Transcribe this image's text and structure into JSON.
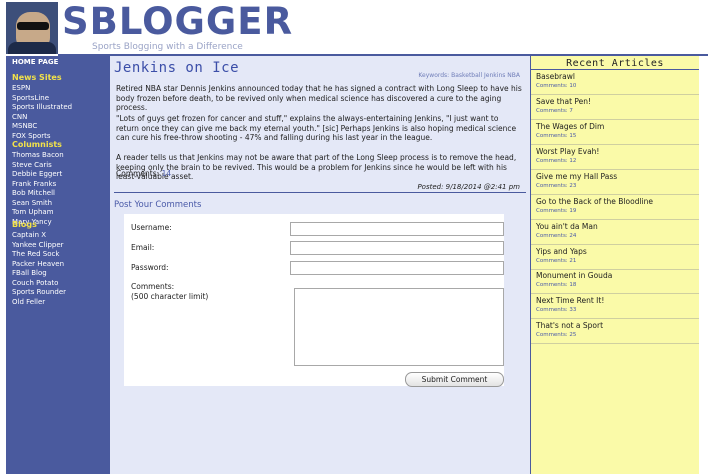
{
  "site": {
    "logo_text": "SBLOGGER",
    "tagline": "Sports Blogging with a Difference"
  },
  "sidebar": {
    "home": "HOME PAGE",
    "groups": [
      {
        "title": "News Sites",
        "items": [
          "ESPN",
          "SportsLine",
          "Sports Illustrated",
          "CNN",
          "MSNBC",
          "FOX Sports"
        ]
      },
      {
        "title": "Columnists",
        "items": [
          "Thomas Bacon",
          "Steve Caris",
          "Debbie Eggert",
          "Frank Franks",
          "Bob Mitchell",
          "Sean Smith",
          "Tom Upham",
          "Mary Yancy"
        ]
      },
      {
        "title": "Blogs",
        "items": [
          "Captain X",
          "Yankee Clipper",
          "The Red Sock",
          "Packer Heaven",
          "FBall Blog",
          "Couch Potato",
          "Sports Rounder",
          "Old Feller"
        ]
      }
    ]
  },
  "article": {
    "title": "Jenkins on Ice",
    "keywords": "Keywords: Basketball Jenkins NBA",
    "paragraphs": [
      "Retired NBA star Dennis Jenkins announced today that he has signed a contract with Long Sleep to have his body frozen before death, to be revived only when medical science has discovered a cure to the aging process.",
      "\"Lots of guys get frozen for cancer and stuff,\" explains the always-entertaining Jenkins, \"I just want to return once they can give me back my eternal youth.\" [sic] Perhaps Jenkins is also hoping medical science can cure his free-throw shooting - 47% and falling during his last year in the league.",
      "A reader tells us that Jenkins may not be aware that part of the Long Sleep process is to remove the head, keeping only the brain to be revived. This would be a problem for Jenkins since he would be left with his least-valuable asset."
    ],
    "comments_label": "Comments:",
    "comments_count": "14",
    "posted": "Posted: 9/18/2014 @2:41 pm"
  },
  "comment_form": {
    "title": "Post Your Comments",
    "username_label": "Username:",
    "email_label": "Email:",
    "password_label": "Password:",
    "comments_label": "Comments:",
    "comments_limit": "(500 character limit)",
    "submit_label": "Submit Comment"
  },
  "recent": {
    "title": "Recent Articles",
    "items": [
      {
        "title": "Basebrawl",
        "comments": "Comments: 10"
      },
      {
        "title": "Save that Pen!",
        "comments": "Comments: 7"
      },
      {
        "title": "The Wages of Dim",
        "comments": "Comments: 15"
      },
      {
        "title": "Worst Play Evah!",
        "comments": "Comments: 12"
      },
      {
        "title": "Give me my Hall Pass",
        "comments": "Comments: 23"
      },
      {
        "title": "Go to the Back of the Bloodline",
        "comments": "Comments: 19"
      },
      {
        "title": "You ain't da Man",
        "comments": "Comments: 24"
      },
      {
        "title": "Yips and Yaps",
        "comments": "Comments: 21"
      },
      {
        "title": "Monument in Gouda",
        "comments": "Comments: 18"
      },
      {
        "title": "Next Time Rent It!",
        "comments": "Comments: 33"
      },
      {
        "title": "That's not a Sport",
        "comments": "Comments: 25"
      }
    ]
  },
  "colors": {
    "brand": "#4a5a9e",
    "sidebar_heading": "#f2e24a",
    "main_bg": "#e4e8f7",
    "right_bg": "#fafaa8"
  }
}
